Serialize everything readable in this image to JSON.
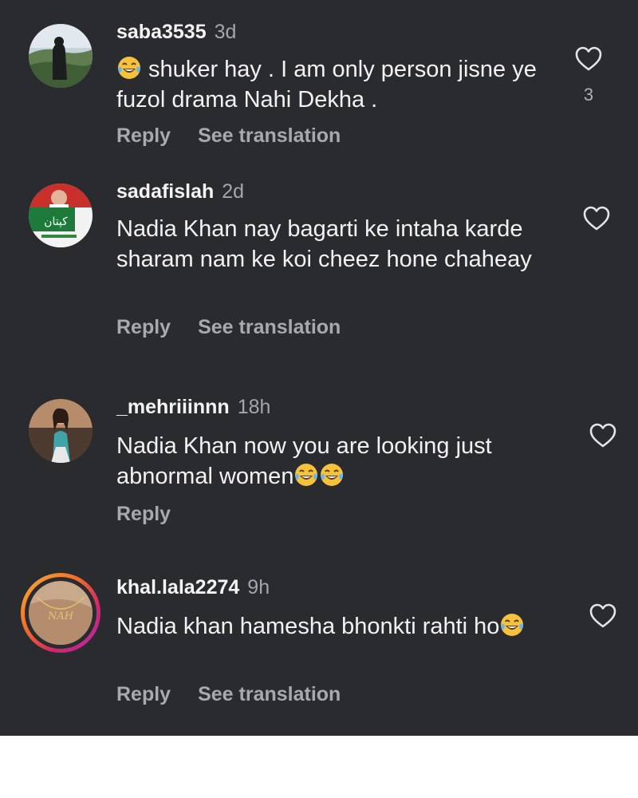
{
  "comments": [
    {
      "username": "saba3535",
      "time": "3d",
      "text_before": "",
      "text_after": " shuker hay . I am only person jisne ye fuzol drama Nahi Dekha .",
      "emoji_lead": "laughing-tears",
      "likes": "3",
      "reply_label": "Reply",
      "translation_label": "See translation"
    },
    {
      "username": "sadafislah",
      "time": "2d",
      "text": "Nadia Khan nay bagarti ke intaha karde sharam nam ke koi cheez hone chaheay",
      "reply_label": "Reply",
      "translation_label": "See translation"
    },
    {
      "username": "_mehriiinnn",
      "time": "18h",
      "text": "Nadia Khan now you are looking just abnormal women",
      "emoji_trail_count": 2,
      "reply_label": "Reply"
    },
    {
      "username": "khal.lala2274",
      "time": "9h",
      "text": "Nadia khan hamesha bhonkti rahti ho",
      "emoji_trail_count": 1,
      "reply_label": "Reply",
      "translation_label": "See translation"
    }
  ],
  "avatar_texts": {
    "sadafislah_badge": "کپتان",
    "khal_ring_necklace": "NAH"
  },
  "colors": {
    "background": "#2a2b2e",
    "text": "#f2f2f2",
    "muted": "#a5a6aa"
  }
}
